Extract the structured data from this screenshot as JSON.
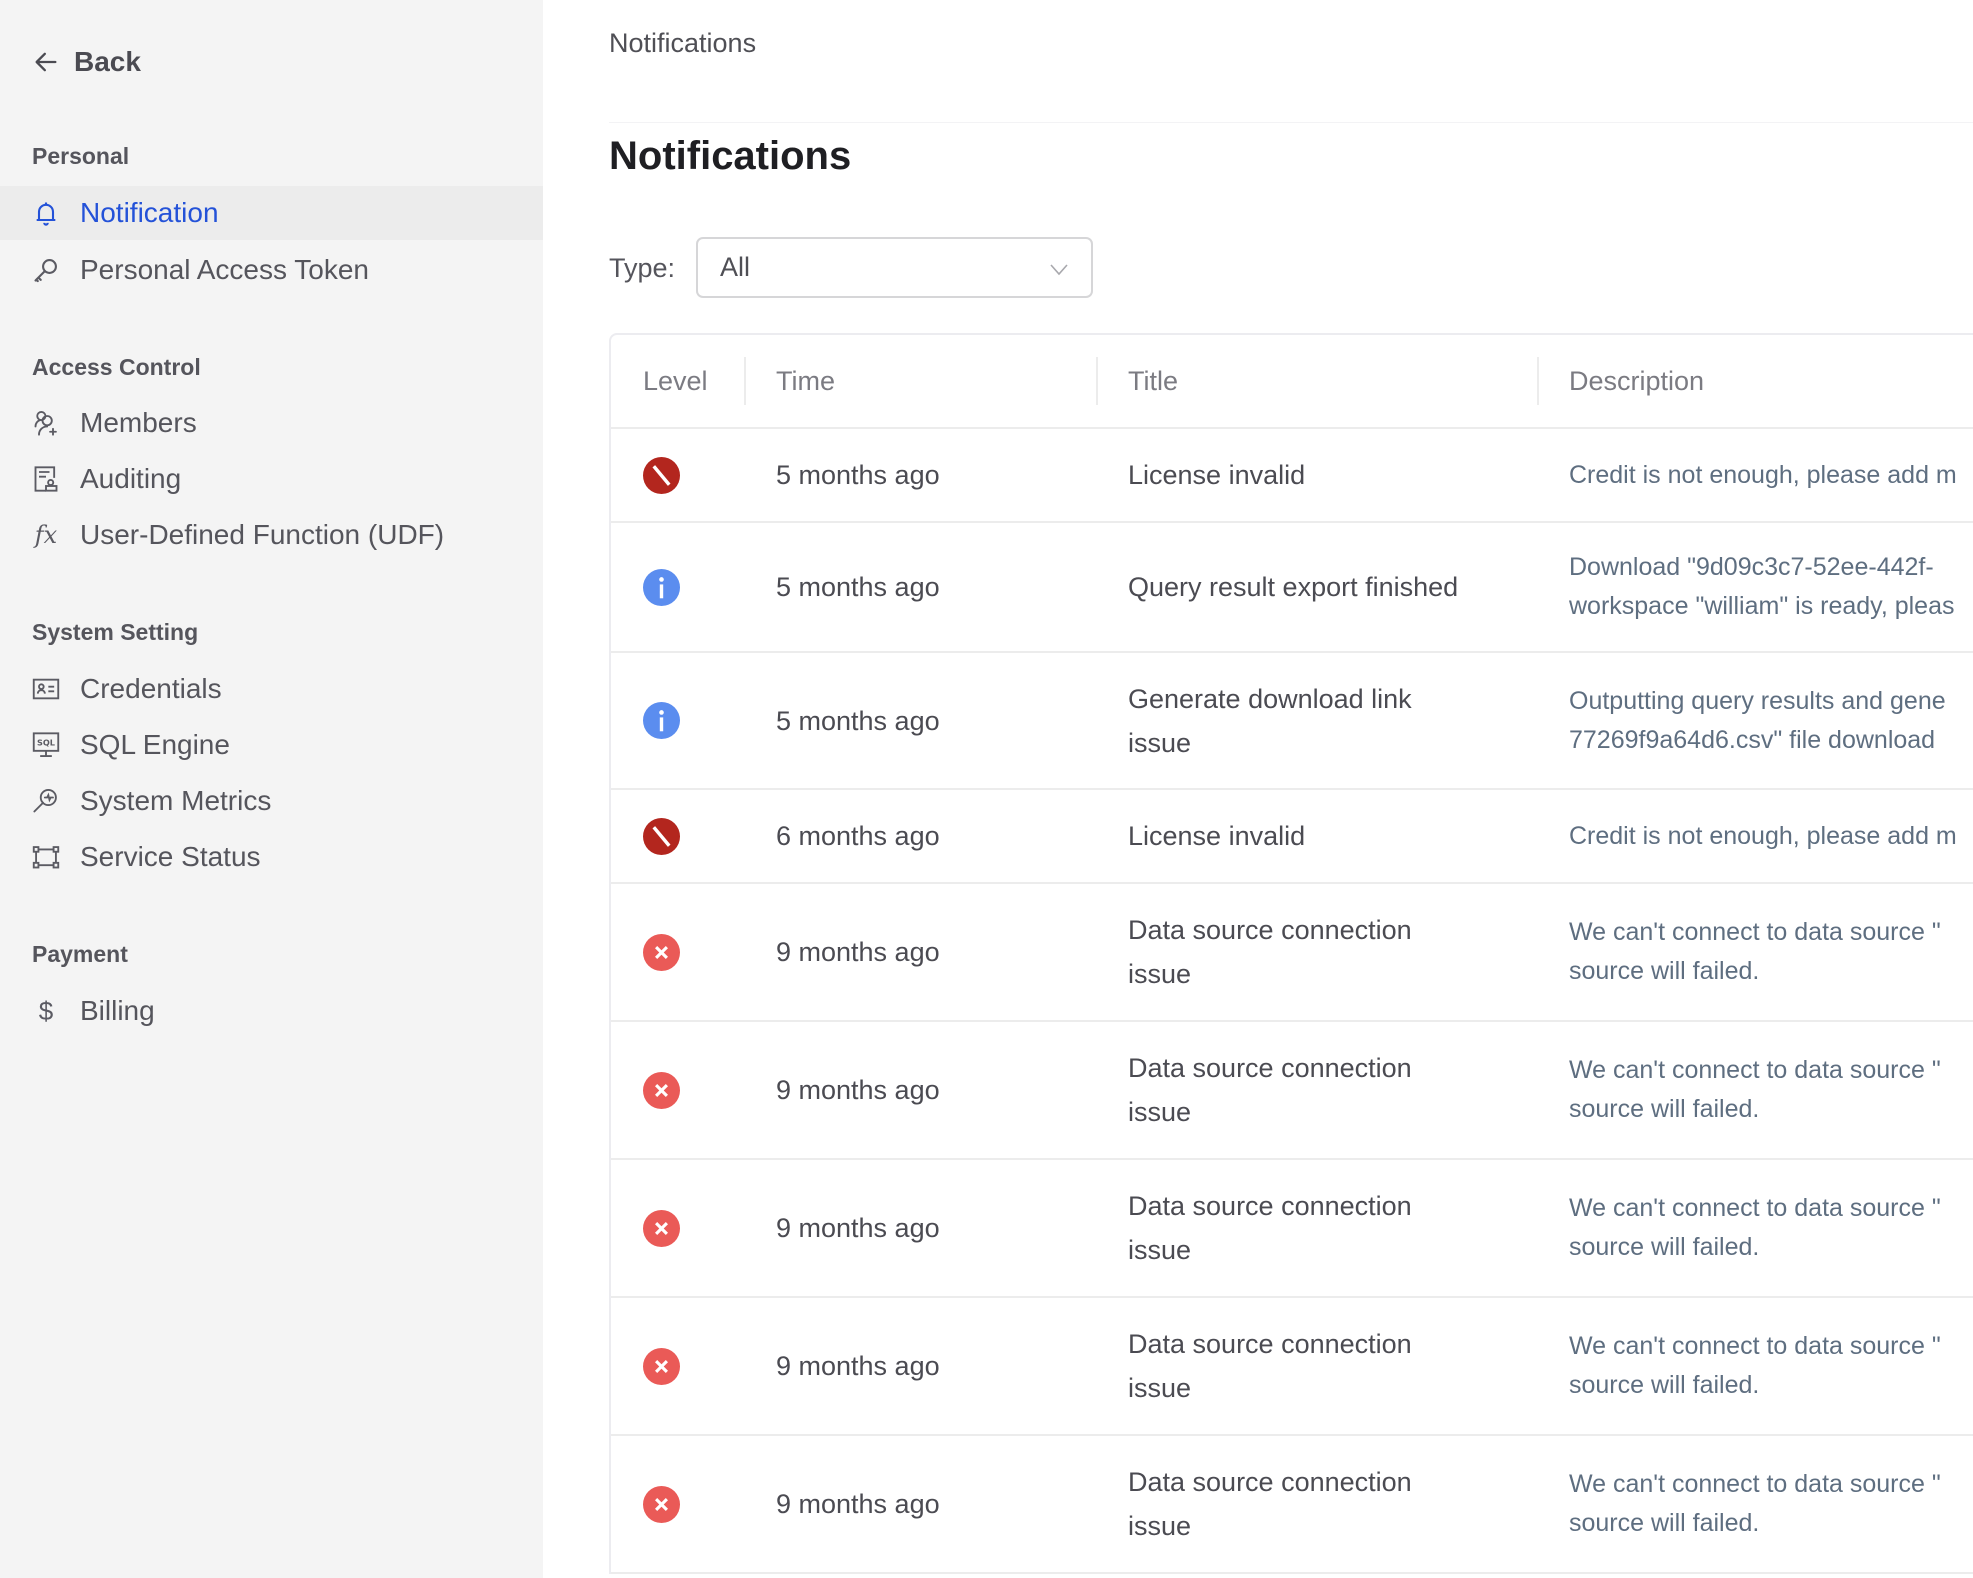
{
  "sidebar": {
    "back_label": "Back",
    "sections": [
      {
        "title": "Personal",
        "items": [
          {
            "label": "Notification",
            "icon": "bell-icon",
            "active": true
          },
          {
            "label": "Personal Access Token",
            "icon": "key-icon",
            "active": false
          }
        ]
      },
      {
        "title": "Access Control",
        "items": [
          {
            "label": "Members",
            "icon": "members-icon",
            "active": false
          },
          {
            "label": "Auditing",
            "icon": "auditing-icon",
            "active": false
          },
          {
            "label": "User-Defined Function (UDF)",
            "icon": "fx-icon",
            "active": false
          }
        ]
      },
      {
        "title": "System Setting",
        "items": [
          {
            "label": "Credentials",
            "icon": "credentials-icon",
            "active": false
          },
          {
            "label": "SQL Engine",
            "icon": "sql-engine-icon",
            "active": false
          },
          {
            "label": "System Metrics",
            "icon": "system-metrics-icon",
            "active": false
          },
          {
            "label": "Service Status",
            "icon": "service-status-icon",
            "active": false
          }
        ]
      },
      {
        "title": "Payment",
        "items": [
          {
            "label": "Billing",
            "icon": "dollar-icon",
            "active": false
          }
        ]
      }
    ]
  },
  "header": {
    "breadcrumb": "Notifications",
    "title": "Notifications"
  },
  "filter": {
    "type_label": "Type:",
    "type_value": "All"
  },
  "table": {
    "columns": [
      "Level",
      "Time",
      "Title",
      "Description"
    ],
    "rows": [
      {
        "level": "license-error",
        "time": "5 months ago",
        "title": [
          "License invalid"
        ],
        "description": [
          "Credit is not enough, please add m"
        ]
      },
      {
        "level": "info",
        "time": "5 months ago",
        "title": [
          "Query result export finished"
        ],
        "description": [
          "Download \"9d09c3c7-52ee-442f-",
          "workspace \"william\" is ready, pleas"
        ]
      },
      {
        "level": "info",
        "time": "5 months ago",
        "title": [
          "Generate download link",
          "issue"
        ],
        "description": [
          "Outputting query results and gene",
          "77269f9a64d6.csv\" file download"
        ]
      },
      {
        "level": "license-error",
        "time": "6 months ago",
        "title": [
          "License invalid"
        ],
        "description": [
          "Credit is not enough, please add m"
        ]
      },
      {
        "level": "error",
        "time": "9 months ago",
        "title": [
          "Data source connection",
          "issue"
        ],
        "description": [
          "We can't connect to data source \"",
          "source will failed."
        ]
      },
      {
        "level": "error",
        "time": "9 months ago",
        "title": [
          "Data source connection",
          "issue"
        ],
        "description": [
          "We can't connect to data source \"",
          "source will failed."
        ]
      },
      {
        "level": "error",
        "time": "9 months ago",
        "title": [
          "Data source connection",
          "issue"
        ],
        "description": [
          "We can't connect to data source \"",
          "source will failed."
        ]
      },
      {
        "level": "error",
        "time": "9 months ago",
        "title": [
          "Data source connection",
          "issue"
        ],
        "description": [
          "We can't connect to data source \"",
          "source will failed."
        ]
      },
      {
        "level": "error",
        "time": "9 months ago",
        "title": [
          "Data source connection",
          "issue"
        ],
        "description": [
          "We can't connect to data source \"",
          "source will failed."
        ]
      }
    ]
  },
  "colors": {
    "accent": "#2452d8",
    "license_error": "#b3261e",
    "info": "#5b8def",
    "error": "#ea5a57"
  }
}
